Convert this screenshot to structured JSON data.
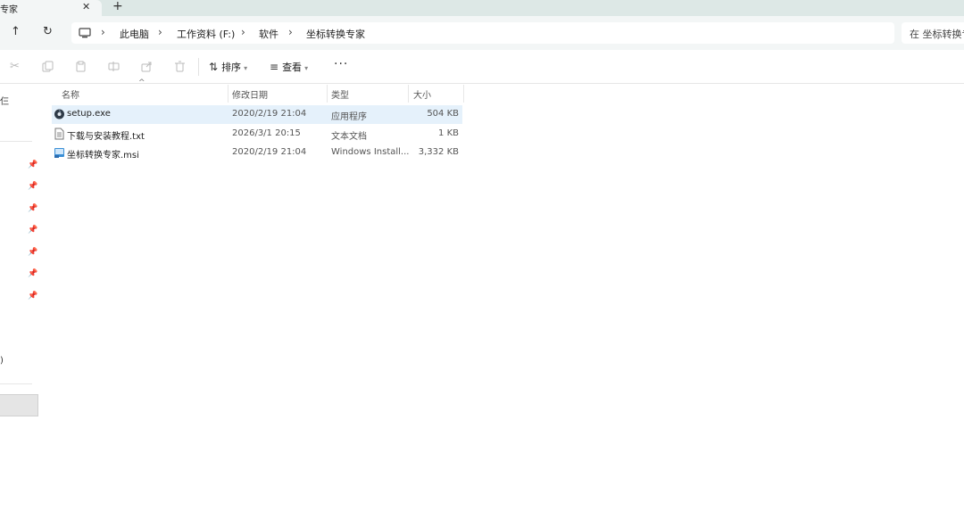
{
  "tab": {
    "title": "专家",
    "close": "✕",
    "new_tab": "+"
  },
  "nav": {
    "up": "↑",
    "refresh": "↻",
    "breadcrumb": [
      "此电脑",
      "工作资料 (F:)",
      "软件",
      "坐标转换专家"
    ],
    "separator": "›",
    "search_placeholder": "在 坐标转换专"
  },
  "toolbar": {
    "sort_label": "排序",
    "view_label": "查看",
    "more": "···"
  },
  "sidebar": {
    "fragment_top": "仨",
    "fragment_mid": ")"
  },
  "columns": {
    "name": "名称",
    "modified": "修改日期",
    "type": "类型",
    "size": "大小"
  },
  "files": [
    {
      "name": "setup.exe",
      "modified": "2020/2/19 21:04",
      "type": "应用程序",
      "size": "504 KB",
      "icon": "setup-exe-icon"
    },
    {
      "name": "下载与安装教程.txt",
      "modified": "2026/3/1 20:15",
      "type": "文本文档",
      "size": "1 KB",
      "icon": "text-file-icon"
    },
    {
      "name": "坐标转换专家.msi",
      "modified": "2020/2/19 21:04",
      "type": "Windows Install...",
      "size": "3,332 KB",
      "icon": "msi-installer-icon"
    }
  ],
  "colors": {
    "selection": "#e5f1fb",
    "chrome": "#f3f6f6",
    "tabstrip": "#dde8e6"
  }
}
